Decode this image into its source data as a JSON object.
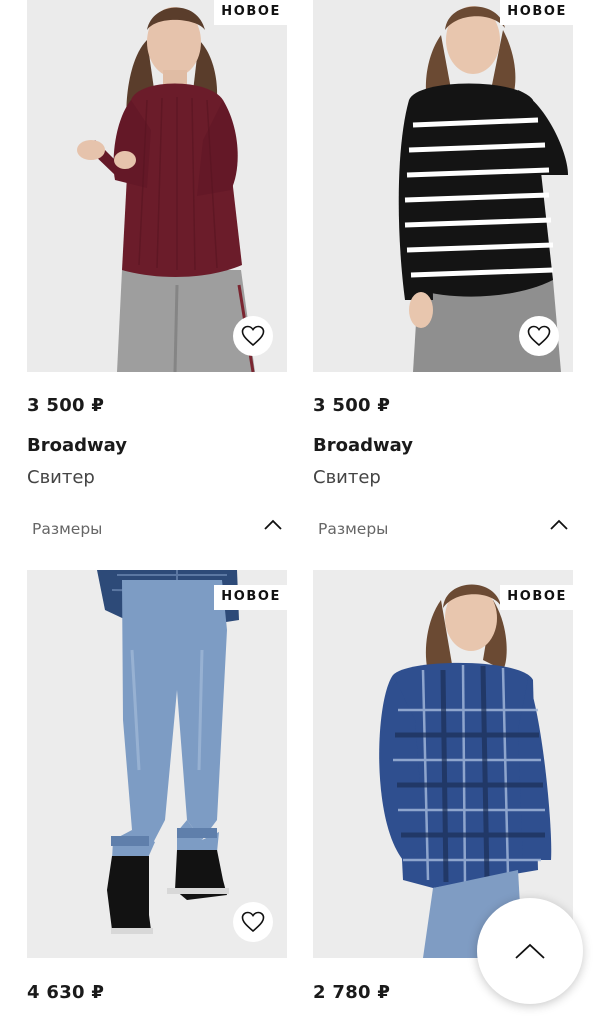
{
  "colors": {
    "text_primary": "#1a1a1a",
    "text_secondary": "#444444",
    "badge_bg": "#ffffff",
    "page_bg": "#ffffff"
  },
  "products": [
    {
      "badge": "НОВОЕ",
      "price": "3 500 ₽",
      "brand": "Broadway",
      "type": "Свитер",
      "sizes_label": "Размеры",
      "image": "model-burgundy-ribbed-sweater",
      "favorite_icon": "heart-outline-icon"
    },
    {
      "badge": "НОВОЕ",
      "price": "3 500 ₽",
      "brand": "Broadway",
      "type": "Свитер",
      "sizes_label": "Размеры",
      "image": "model-black-white-striped-sweater",
      "favorite_icon": "heart-outline-icon"
    },
    {
      "badge": "НОВОЕ",
      "price": "4 630 ₽",
      "image": "model-light-blue-skinny-jeans",
      "favorite_icon": "heart-outline-icon"
    },
    {
      "badge": "НОВОЕ",
      "price": "2 780 ₽",
      "image": "model-blue-plaid-shirt",
      "favorite_icon": "heart-outline-icon"
    }
  ],
  "scroll_top_icon": "chevron-up-icon"
}
